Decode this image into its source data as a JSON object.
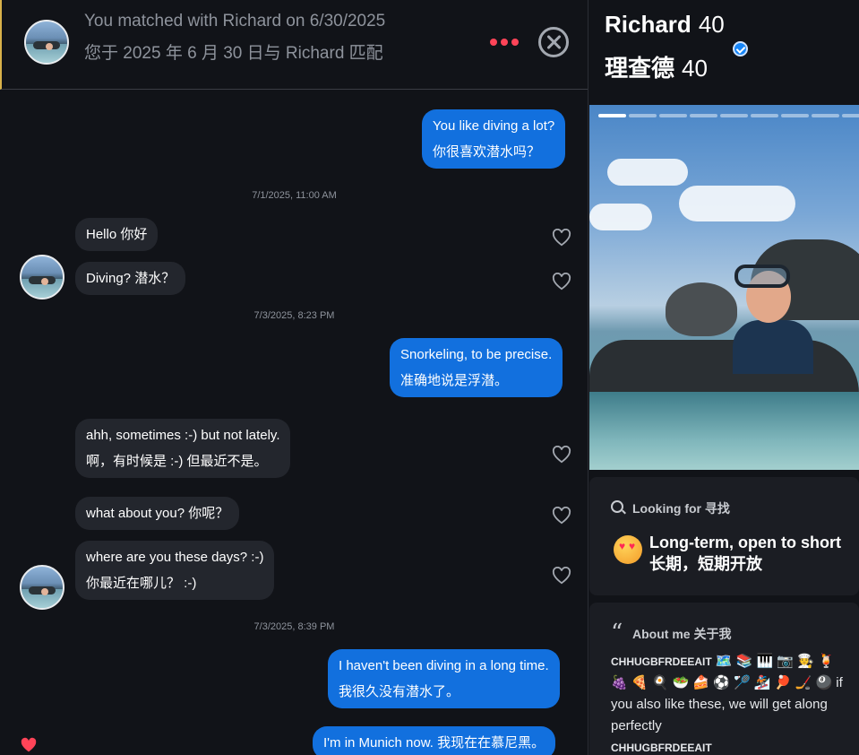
{
  "header": {
    "match_en": "You matched with Richard on 6/30/2025",
    "match_zh": "您于 2025 年 6 月 30 日与 Richard 匹配",
    "more_icon": "more-dots-icon",
    "close_icon": "close-circle-icon"
  },
  "messages": [
    {
      "dir": "out",
      "lines": [
        "You like diving a lot?",
        "你很喜欢潜水吗？"
      ]
    },
    {
      "ts": "7/1/2025, 11:00 AM"
    },
    {
      "dir": "in",
      "lines": [
        "Hello  你好"
      ]
    },
    {
      "dir": "in",
      "lines": [
        "Diving?  潜水？"
      ]
    },
    {
      "ts": "7/3/2025, 8:23 PM"
    },
    {
      "dir": "out",
      "lines": [
        "Snorkeling, to be precise.",
        "准确地说是浮潜。"
      ]
    },
    {
      "dir": "in",
      "lines": [
        "ahh, sometimes :-) but not lately.",
        "啊，有时候是 :-) 但最近不是。"
      ]
    },
    {
      "dir": "in",
      "lines": [
        "what about you?  你呢？"
      ]
    },
    {
      "dir": "in",
      "lines": [
        "where are you these days? :-)",
        "你最近在哪儿？ :-)"
      ]
    },
    {
      "ts": "7/3/2025, 8:39 PM"
    },
    {
      "dir": "out",
      "lines": [
        "I haven't been diving in a long time.",
        "我很久没有潜水了。"
      ]
    },
    {
      "dir": "out",
      "lines": [
        "I'm in Munich now.  我现在在慕尼黑。"
      ]
    }
  ],
  "profile": {
    "name_en": "Richard",
    "name_zh": "理查德",
    "age": "40",
    "photo_count": 9,
    "photo_index": 1,
    "looking_for": {
      "title": "Looking for  寻找",
      "value": "Long-term, open to short  长期，短期开放"
    },
    "about": {
      "title": "About me  关于我",
      "caps": "CHHUGBFRDEEAIT",
      "emoji_row1": "🗺️ 📚 🎹 📷 🧑‍🍳 🍹",
      "emoji_row2": "🍇 🍕 🍳 🥗 🍰 ⚽ 🏸 🏂 🏓 🏒 🎱",
      "text": "if you also like these, we will get along perfectly",
      "caps2": "CHHUGBFRDEEAIT"
    }
  },
  "colors": {
    "outgoing_bubble": "#1270de",
    "incoming_bubble": "#23262d",
    "accent": "#ff4458",
    "background": "#111318"
  }
}
